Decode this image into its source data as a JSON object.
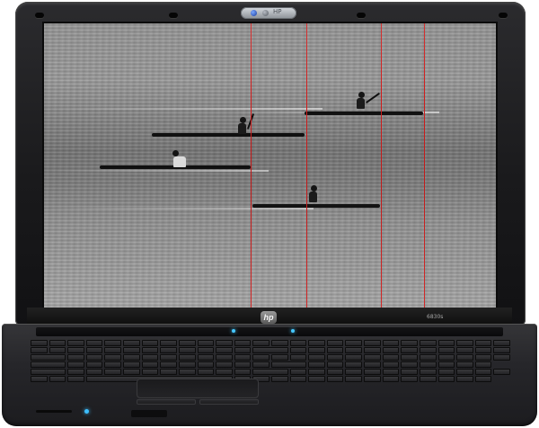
{
  "laptop": {
    "brand_logo": "hp",
    "model": "6830s",
    "webcam_label": "HP",
    "screen": {
      "content": "photograph",
      "race_lane_markers": 4,
      "marker_color": "#d21b1b",
      "kayakers": 4
    },
    "icons": [
      "webcam-icon",
      "hp-logo-icon",
      "power-led-icon"
    ]
  }
}
